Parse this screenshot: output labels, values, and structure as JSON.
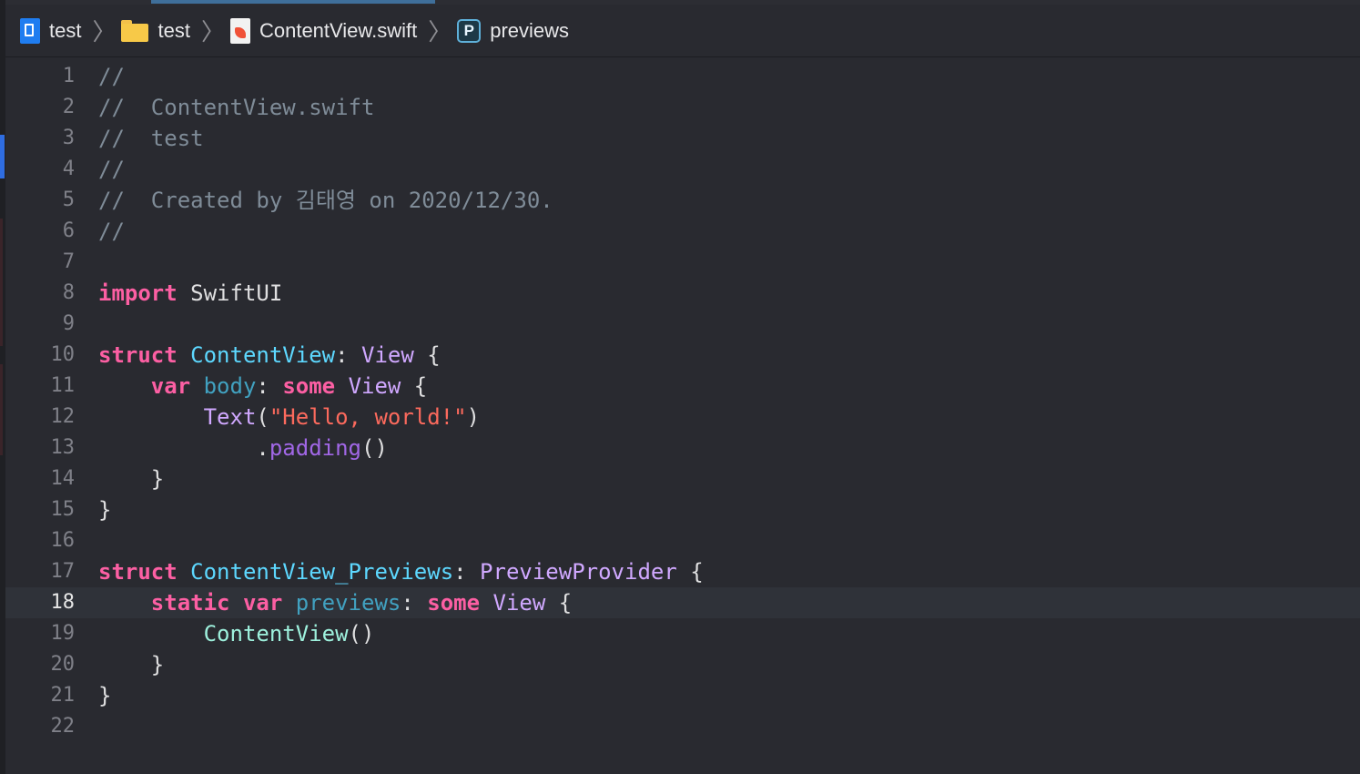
{
  "jumpbar": {
    "crumbs": [
      {
        "label": "test",
        "icon": "xcode-project-icon"
      },
      {
        "label": "test",
        "icon": "folder-icon"
      },
      {
        "label": "ContentView.swift",
        "icon": "swift-file-icon"
      },
      {
        "label": "previews",
        "icon": "property-icon",
        "badge": "P"
      }
    ]
  },
  "editor": {
    "current_line": "18",
    "lines": [
      {
        "n": "1",
        "tokens": [
          {
            "t": "//",
            "c": "comment"
          }
        ]
      },
      {
        "n": "2",
        "tokens": [
          {
            "t": "//  ContentView.swift",
            "c": "comment"
          }
        ]
      },
      {
        "n": "3",
        "tokens": [
          {
            "t": "//  test",
            "c": "comment"
          }
        ]
      },
      {
        "n": "4",
        "tokens": [
          {
            "t": "//",
            "c": "comment"
          }
        ]
      },
      {
        "n": "5",
        "tokens": [
          {
            "t": "//  Created by 김태영 on 2020/12/30.",
            "c": "comment"
          }
        ]
      },
      {
        "n": "6",
        "tokens": [
          {
            "t": "//",
            "c": "comment"
          }
        ]
      },
      {
        "n": "7",
        "tokens": []
      },
      {
        "n": "8",
        "tokens": [
          {
            "t": "import",
            "c": "kw"
          },
          {
            "t": " SwiftUI",
            "c": "plain"
          }
        ]
      },
      {
        "n": "9",
        "tokens": []
      },
      {
        "n": "10",
        "tokens": [
          {
            "t": "struct",
            "c": "kw"
          },
          {
            "t": " ",
            "c": "plain"
          },
          {
            "t": "ContentView",
            "c": "type"
          },
          {
            "t": ": ",
            "c": "plain"
          },
          {
            "t": "View",
            "c": "sys"
          },
          {
            "t": " {",
            "c": "plain"
          }
        ]
      },
      {
        "n": "11",
        "tokens": [
          {
            "t": "    ",
            "c": "plain"
          },
          {
            "t": "var",
            "c": "kw"
          },
          {
            "t": " ",
            "c": "plain"
          },
          {
            "t": "body",
            "c": "prop"
          },
          {
            "t": ": ",
            "c": "plain"
          },
          {
            "t": "some",
            "c": "kw"
          },
          {
            "t": " ",
            "c": "plain"
          },
          {
            "t": "View",
            "c": "sys"
          },
          {
            "t": " {",
            "c": "plain"
          }
        ]
      },
      {
        "n": "12",
        "tokens": [
          {
            "t": "        ",
            "c": "plain"
          },
          {
            "t": "Text",
            "c": "sys"
          },
          {
            "t": "(",
            "c": "plain"
          },
          {
            "t": "\"Hello, world!\"",
            "c": "str"
          },
          {
            "t": ")",
            "c": "plain"
          }
        ]
      },
      {
        "n": "13",
        "tokens": [
          {
            "t": "            .",
            "c": "plain"
          },
          {
            "t": "padding",
            "c": "fn"
          },
          {
            "t": "()",
            "c": "plain"
          }
        ]
      },
      {
        "n": "14",
        "tokens": [
          {
            "t": "    }",
            "c": "plain"
          }
        ]
      },
      {
        "n": "15",
        "tokens": [
          {
            "t": "}",
            "c": "plain"
          }
        ]
      },
      {
        "n": "16",
        "tokens": []
      },
      {
        "n": "17",
        "tokens": [
          {
            "t": "struct",
            "c": "kw"
          },
          {
            "t": " ",
            "c": "plain"
          },
          {
            "t": "ContentView_Previews",
            "c": "type"
          },
          {
            "t": ": ",
            "c": "plain"
          },
          {
            "t": "PreviewProvider",
            "c": "sys"
          },
          {
            "t": " {",
            "c": "plain"
          }
        ]
      },
      {
        "n": "18",
        "tokens": [
          {
            "t": "    ",
            "c": "plain"
          },
          {
            "t": "static",
            "c": "kw"
          },
          {
            "t": " ",
            "c": "plain"
          },
          {
            "t": "var",
            "c": "kw"
          },
          {
            "t": " ",
            "c": "plain"
          },
          {
            "t": "previews",
            "c": "prop"
          },
          {
            "t": ": ",
            "c": "plain"
          },
          {
            "t": "some",
            "c": "kw"
          },
          {
            "t": " ",
            "c": "plain"
          },
          {
            "t": "View",
            "c": "sys"
          },
          {
            "t": " {",
            "c": "plain"
          }
        ]
      },
      {
        "n": "19",
        "tokens": [
          {
            "t": "        ",
            "c": "plain"
          },
          {
            "t": "ContentView",
            "c": "user"
          },
          {
            "t": "()",
            "c": "plain"
          }
        ]
      },
      {
        "n": "20",
        "tokens": [
          {
            "t": "    }",
            "c": "plain"
          }
        ]
      },
      {
        "n": "21",
        "tokens": [
          {
            "t": "}",
            "c": "plain"
          }
        ]
      },
      {
        "n": "22",
        "tokens": []
      }
    ]
  },
  "colors": {
    "background": "#292a30",
    "keyword": "#fc5fa3",
    "type": "#5dd8ff",
    "system_type": "#d0a8ff",
    "string": "#fc6a5d",
    "comment": "#7f8c98"
  }
}
